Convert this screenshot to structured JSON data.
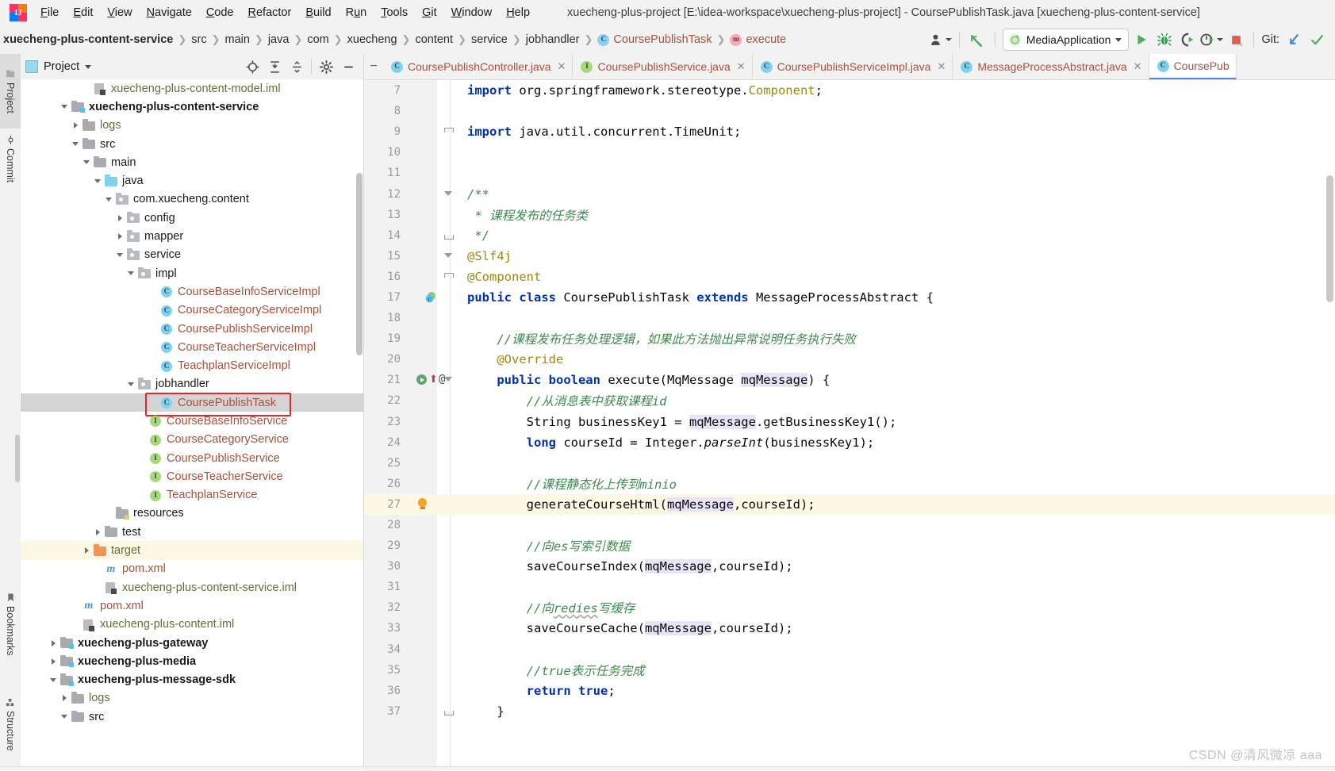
{
  "window": {
    "title": "xuecheng-plus-project [E:\\idea-workspace\\xuecheng-plus-project] - CoursePublishTask.java [xuecheng-plus-content-service]",
    "logo_text": "IJ"
  },
  "menubar": {
    "items": [
      {
        "label": "File",
        "mnemonic": "F"
      },
      {
        "label": "Edit",
        "mnemonic": "E"
      },
      {
        "label": "View",
        "mnemonic": "V"
      },
      {
        "label": "Navigate",
        "mnemonic": "N"
      },
      {
        "label": "Code",
        "mnemonic": "C"
      },
      {
        "label": "Refactor",
        "mnemonic": "R"
      },
      {
        "label": "Build",
        "mnemonic": "B"
      },
      {
        "label": "Run",
        "mnemonic": "u"
      },
      {
        "label": "Tools",
        "mnemonic": "T"
      },
      {
        "label": "Git",
        "mnemonic": "G"
      },
      {
        "label": "Window",
        "mnemonic": "W"
      },
      {
        "label": "Help",
        "mnemonic": "H"
      }
    ]
  },
  "breadcrumb": {
    "items": [
      {
        "label": "xuecheng-plus-content-service",
        "bold": true,
        "icon": "none"
      },
      {
        "label": "src",
        "bold": false,
        "icon": "none"
      },
      {
        "label": "main",
        "bold": false,
        "icon": "none"
      },
      {
        "label": "java",
        "bold": false,
        "icon": "none"
      },
      {
        "label": "com",
        "bold": false,
        "icon": "none"
      },
      {
        "label": "xuecheng",
        "bold": false,
        "icon": "none"
      },
      {
        "label": "content",
        "bold": false,
        "icon": "none"
      },
      {
        "label": "service",
        "bold": false,
        "icon": "none"
      },
      {
        "label": "jobhandler",
        "bold": false,
        "icon": "none"
      },
      {
        "label": "CoursePublishTask",
        "bold": false,
        "icon": "class",
        "icon_letter": "C",
        "orange": true
      },
      {
        "label": "execute",
        "bold": false,
        "icon": "method",
        "icon_letter": "m",
        "orange": true
      }
    ]
  },
  "toolbar": {
    "user_icon": "user-silhouette-icon",
    "updates_icon": "update-arrow-icon",
    "run_config": {
      "label": "MediaApplication",
      "icon": "spring-boot-icon"
    },
    "run_button": "run-icon",
    "debug_button": "debug-bug-icon",
    "run_coverage_button": "run-with-coverage-icon",
    "profiler_button": "profiler-icon",
    "stop_button": "stop-icon",
    "git_label": "Git:",
    "git_update_icon": "update-project-icon",
    "git_commit_icon": "commit-checkmark-icon"
  },
  "toolstrip": {
    "tabs": [
      {
        "label": "Project",
        "icon": "project-folder-icon",
        "selected": true
      },
      {
        "label": "Commit",
        "icon": "commit-icon",
        "selected": false
      }
    ],
    "bottom_tabs": [
      {
        "label": "Bookmarks",
        "icon": "bookmark-icon",
        "selected": false
      },
      {
        "label": "Structure",
        "icon": "structure-icon",
        "selected": false
      }
    ]
  },
  "project_panel": {
    "title": "Project",
    "title_icon": "project-icon",
    "dropdown_icon": "chevron-down-icon",
    "actions": [
      {
        "name": "scroll-from-source-icon",
        "glyph": "target-crosshair"
      },
      {
        "name": "expand-all-icon",
        "glyph": "expand"
      },
      {
        "name": "collapse-all-icon",
        "glyph": "collapse"
      },
      {
        "name": "settings-gear-icon",
        "glyph": "gear"
      },
      {
        "name": "hide-panel-icon",
        "glyph": "minus"
      }
    ],
    "tree": [
      {
        "label": "xuecheng-plus-content-model.iml",
        "indent": 5,
        "arrow": "none",
        "icon": "iml",
        "style": "olive",
        "state": "normal"
      },
      {
        "label": "xuecheng-plus-content-service",
        "indent": 3,
        "arrow": "down",
        "icon": "module",
        "style": "bold",
        "state": "normal"
      },
      {
        "label": "logs",
        "indent": 4,
        "arrow": "right",
        "icon": "folder",
        "style": "olive",
        "state": "normal"
      },
      {
        "label": "src",
        "indent": 4,
        "arrow": "down",
        "icon": "folder",
        "style": "normal",
        "state": "normal"
      },
      {
        "label": "main",
        "indent": 5,
        "arrow": "down",
        "icon": "folder",
        "style": "normal",
        "state": "normal"
      },
      {
        "label": "java",
        "indent": 6,
        "arrow": "down",
        "icon": "folder-blue",
        "style": "normal",
        "state": "normal"
      },
      {
        "label": "com.xuecheng.content",
        "indent": 7,
        "arrow": "down",
        "icon": "package",
        "style": "normal",
        "state": "normal"
      },
      {
        "label": "config",
        "indent": 8,
        "arrow": "right",
        "icon": "package",
        "style": "normal",
        "state": "normal"
      },
      {
        "label": "mapper",
        "indent": 8,
        "arrow": "right",
        "icon": "package",
        "style": "normal",
        "state": "normal"
      },
      {
        "label": "service",
        "indent": 8,
        "arrow": "down",
        "icon": "package",
        "style": "normal",
        "state": "normal"
      },
      {
        "label": "impl",
        "indent": 9,
        "arrow": "down",
        "icon": "package",
        "style": "normal",
        "state": "normal"
      },
      {
        "label": "CourseBaseInfoServiceImpl",
        "indent": 11,
        "arrow": "none",
        "icon": "class",
        "style": "orange",
        "state": "normal"
      },
      {
        "label": "CourseCategoryServiceImpl",
        "indent": 11,
        "arrow": "none",
        "icon": "class",
        "style": "orange",
        "state": "normal"
      },
      {
        "label": "CoursePublishServiceImpl",
        "indent": 11,
        "arrow": "none",
        "icon": "class",
        "style": "orange",
        "state": "normal"
      },
      {
        "label": "CourseTeacherServiceImpl",
        "indent": 11,
        "arrow": "none",
        "icon": "class",
        "style": "orange",
        "state": "normal"
      },
      {
        "label": "TeachplanServiceImpl",
        "indent": 11,
        "arrow": "none",
        "icon": "class",
        "style": "orange",
        "state": "normal"
      },
      {
        "label": "jobhandler",
        "indent": 9,
        "arrow": "down",
        "icon": "package",
        "style": "normal",
        "state": "normal"
      },
      {
        "label": "CoursePublishTask",
        "indent": 11,
        "arrow": "none",
        "icon": "class",
        "style": "orange",
        "state": "selected"
      },
      {
        "label": "CourseBaseInfoService",
        "indent": 10,
        "arrow": "none",
        "icon": "interface",
        "style": "orange",
        "state": "normal"
      },
      {
        "label": "CourseCategoryService",
        "indent": 10,
        "arrow": "none",
        "icon": "interface",
        "style": "orange",
        "state": "normal"
      },
      {
        "label": "CoursePublishService",
        "indent": 10,
        "arrow": "none",
        "icon": "interface",
        "style": "orange",
        "state": "normal"
      },
      {
        "label": "CourseTeacherService",
        "indent": 10,
        "arrow": "none",
        "icon": "interface",
        "style": "orange",
        "state": "normal"
      },
      {
        "label": "TeachplanService",
        "indent": 10,
        "arrow": "none",
        "icon": "interface",
        "style": "orange",
        "state": "normal"
      },
      {
        "label": "resources",
        "indent": 7,
        "arrow": "none",
        "icon": "folder-res",
        "style": "normal",
        "state": "normal"
      },
      {
        "label": "test",
        "indent": 6,
        "arrow": "right",
        "icon": "folder",
        "style": "normal",
        "state": "normal"
      },
      {
        "label": "target",
        "indent": 5,
        "arrow": "right",
        "icon": "folder-orange",
        "style": "olive",
        "state": "highlight"
      },
      {
        "label": "pom.xml",
        "indent": 6,
        "arrow": "none",
        "icon": "maven",
        "style": "orange",
        "state": "normal"
      },
      {
        "label": "xuecheng-plus-content-service.iml",
        "indent": 6,
        "arrow": "none",
        "icon": "iml",
        "style": "olive",
        "state": "normal"
      },
      {
        "label": "pom.xml",
        "indent": 4,
        "arrow": "none",
        "icon": "maven",
        "style": "orange",
        "state": "normal"
      },
      {
        "label": "xuecheng-plus-content.iml",
        "indent": 4,
        "arrow": "none",
        "icon": "iml",
        "style": "olive",
        "state": "normal"
      },
      {
        "label": "xuecheng-plus-gateway",
        "indent": 2,
        "arrow": "right",
        "icon": "module",
        "style": "bold",
        "state": "normal"
      },
      {
        "label": "xuecheng-plus-media",
        "indent": 2,
        "arrow": "right",
        "icon": "module",
        "style": "bold",
        "state": "normal"
      },
      {
        "label": "xuecheng-plus-message-sdk",
        "indent": 2,
        "arrow": "down",
        "icon": "module",
        "style": "bold",
        "state": "normal"
      },
      {
        "label": "logs",
        "indent": 3,
        "arrow": "right",
        "icon": "folder",
        "style": "olive",
        "state": "normal"
      },
      {
        "label": "src",
        "indent": 3,
        "arrow": "down",
        "icon": "folder",
        "style": "normal",
        "state": "normal"
      }
    ]
  },
  "editor": {
    "tabs": [
      {
        "label": "CoursePublishController.java",
        "icon": "class",
        "icon_letter": "C",
        "active": false,
        "closable": true
      },
      {
        "label": "CoursePublishService.java",
        "icon": "interface",
        "icon_letter": "I",
        "active": false,
        "closable": true
      },
      {
        "label": "CoursePublishServiceImpl.java",
        "icon": "class",
        "icon_letter": "C",
        "active": false,
        "closable": true
      },
      {
        "label": "MessageProcessAbstract.java",
        "icon": "class",
        "icon_letter": "C",
        "active": false,
        "closable": true
      },
      {
        "label": "CoursePub",
        "icon": "class",
        "icon_letter": "C",
        "active": true,
        "closable": false
      }
    ],
    "collapse_icon": "collapse-tabs-icon",
    "first_line_number": 7,
    "current_line": 27,
    "lines": [
      {
        "n": 7,
        "fold": "none",
        "gutter": "none",
        "html": "<span class='kw'>import</span> org.springframework.stereotype.<span class='ann'>Component</span>;",
        "text": "import org.springframework.stereotype.Component;"
      },
      {
        "n": 8,
        "fold": "none",
        "gutter": "none",
        "html": "",
        "text": ""
      },
      {
        "n": 9,
        "fold": "top",
        "gutter": "none",
        "html": "<span class='kw'>import</span> java.util.concurrent.TimeUnit;",
        "text": "import java.util.concurrent.TimeUnit;"
      },
      {
        "n": 10,
        "fold": "none",
        "gutter": "none",
        "html": "",
        "text": ""
      },
      {
        "n": 11,
        "fold": "none",
        "gutter": "none",
        "html": "",
        "text": ""
      },
      {
        "n": 12,
        "fold": "tri",
        "gutter": "none",
        "html": "<span class='cmt'>/**</span>",
        "text": "/**"
      },
      {
        "n": 13,
        "fold": "none",
        "gutter": "none",
        "html": "<span class='cmt'> * 课程发布的任务类</span>",
        "text": " * 课程发布的任务类"
      },
      {
        "n": 14,
        "fold": "bot",
        "gutter": "none",
        "html": "<span class='cmt'> */</span>",
        "text": " */"
      },
      {
        "n": 15,
        "fold": "tri",
        "gutter": "none",
        "html": "<span class='ann'>@Slf4j</span>",
        "text": "@Slf4j"
      },
      {
        "n": 16,
        "fold": "top",
        "gutter": "none",
        "html": "<span class='ann'>@Component</span>",
        "text": "@Component"
      },
      {
        "n": 17,
        "fold": "none",
        "gutter": "impl",
        "html": "<span class='kw'>public class</span> CoursePublishTask <span class='kw'>extends</span> MessageProcessAbstract {",
        "text": "public class CoursePublishTask extends MessageProcessAbstract {"
      },
      {
        "n": 18,
        "fold": "none",
        "gutter": "none",
        "html": "",
        "text": ""
      },
      {
        "n": 19,
        "fold": "none",
        "gutter": "none",
        "html": "    <span class='cmt'>//课程发布任务处理逻辑，如果此方法抛出异常说明任务执行失败</span>",
        "text": "    //课程发布任务处理逻辑，如果此方法抛出异常说明任务执行失败"
      },
      {
        "n": 20,
        "fold": "none",
        "gutter": "none",
        "html": "    <span class='ann'>@Override</span>",
        "text": "    @Override"
      },
      {
        "n": 21,
        "fold": "tri",
        "gutter": "run-override",
        "html": "    <span class='kw'>public boolean</span> execute(MqMessage <span class='hlid'>mqMessage</span>) {",
        "text": "    public boolean execute(MqMessage mqMessage) {"
      },
      {
        "n": 22,
        "fold": "none",
        "gutter": "none",
        "html": "        <span class='cmt'>//从消息表中获取课程id</span>",
        "text": "        //从消息表中获取课程id"
      },
      {
        "n": 23,
        "fold": "none",
        "gutter": "none",
        "html": "        String businessKey1 = <span class='hlid'>mqMessage</span>.getBusinessKey1();",
        "text": "        String businessKey1 = mqMessage.getBusinessKey1();"
      },
      {
        "n": 24,
        "fold": "none",
        "gutter": "none",
        "html": "        <span class='kw'>long</span> courseId = Integer.<span class='ital'>parseInt</span>(businessKey1);",
        "text": "        long courseId = Integer.parseInt(businessKey1);"
      },
      {
        "n": 25,
        "fold": "none",
        "gutter": "none",
        "html": "",
        "text": ""
      },
      {
        "n": 26,
        "fold": "none",
        "gutter": "none",
        "html": "        <span class='cmt'>//课程静态化上传到minio</span>",
        "text": "        //课程静态化上传到minio"
      },
      {
        "n": 27,
        "fold": "none",
        "gutter": "bulb",
        "html": "        generateCourseHtml(<span class='hlid'>mqMessage</span>,courseId);",
        "text": "        generateCourseHtml(mqMessage,courseId);"
      },
      {
        "n": 28,
        "fold": "none",
        "gutter": "none",
        "html": "",
        "text": ""
      },
      {
        "n": 29,
        "fold": "none",
        "gutter": "none",
        "html": "        <span class='cmt'>//向es写索引数据</span>",
        "text": "        //向es写索引数据"
      },
      {
        "n": 30,
        "fold": "none",
        "gutter": "none",
        "html": "        saveCourseIndex(<span class='hlid'>mqMessage</span>,courseId);",
        "text": "        saveCourseIndex(mqMessage,courseId);"
      },
      {
        "n": 31,
        "fold": "none",
        "gutter": "none",
        "html": "",
        "text": ""
      },
      {
        "n": 32,
        "fold": "none",
        "gutter": "none",
        "html": "        <span class='cmt'>//向<span class='typo'>redies</span>写缓存</span>",
        "text": "        //向redies写缓存"
      },
      {
        "n": 33,
        "fold": "none",
        "gutter": "none",
        "html": "        saveCourseCache(<span class='hlid'>mqMessage</span>,courseId);",
        "text": "        saveCourseCache(mqMessage,courseId);"
      },
      {
        "n": 34,
        "fold": "none",
        "gutter": "none",
        "html": "",
        "text": ""
      },
      {
        "n": 35,
        "fold": "none",
        "gutter": "none",
        "html": "        <span class='cmt'>//true表示任务完成</span>",
        "text": "        //true表示任务完成"
      },
      {
        "n": 36,
        "fold": "none",
        "gutter": "none",
        "html": "        <span class='kw'>return</span> <span class='kw'>true</span>;",
        "text": "        return true;"
      },
      {
        "n": 37,
        "fold": "bot",
        "gutter": "none",
        "html": "    }",
        "text": "    }"
      }
    ]
  },
  "watermark": {
    "text": "CSDN @清风微凉 aaa"
  },
  "colors": {
    "accent_blue": "#4a90d9",
    "keyword": "#0033b3",
    "comment": "#3d8a4f",
    "annotation": "#9e880d",
    "class_orange": "#a9503a",
    "run_green": "#59a869",
    "highlight_yellow": "#fcf8e3",
    "selection_gray": "#d4d4d4",
    "red_annotation": "#e8262a"
  }
}
